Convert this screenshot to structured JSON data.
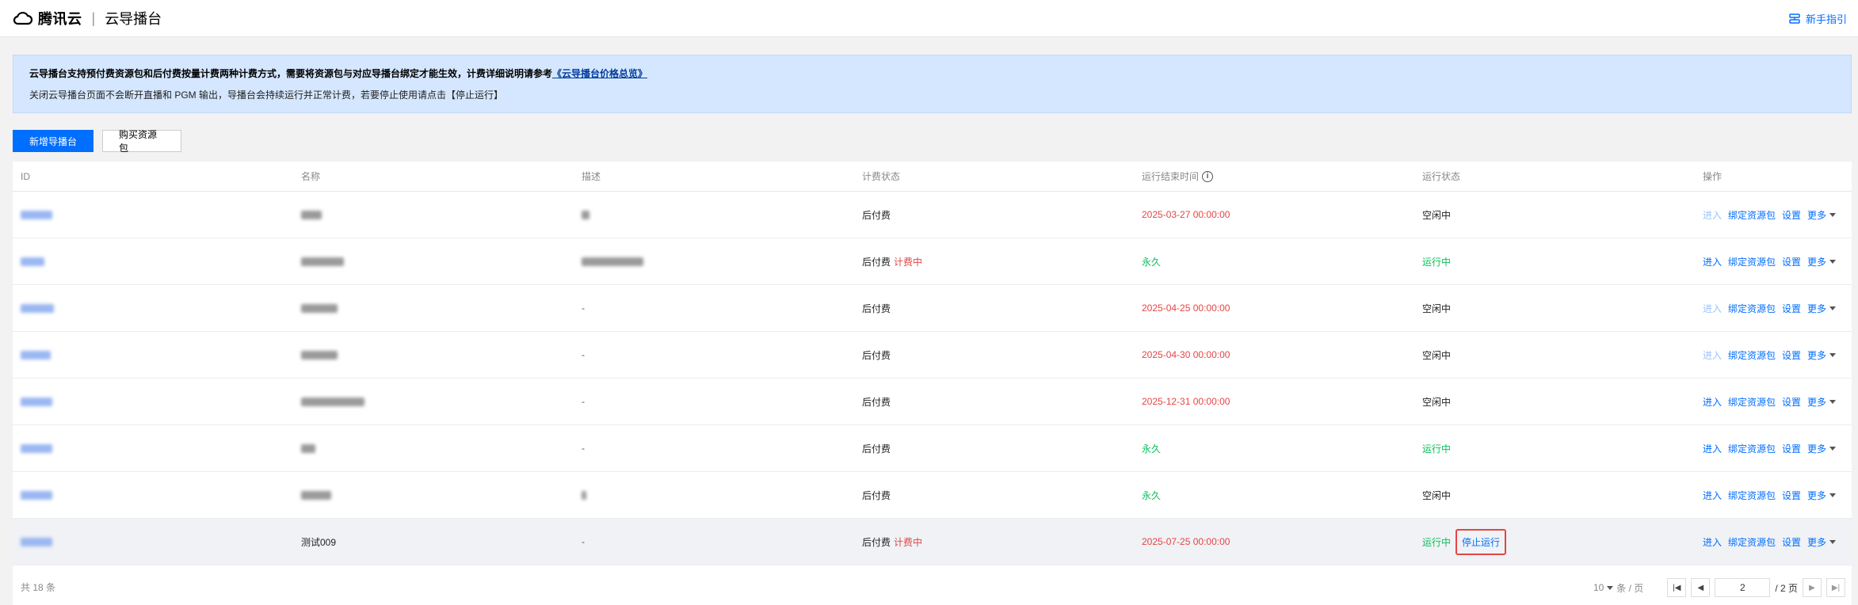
{
  "header": {
    "brand": "腾讯云",
    "separator": "|",
    "product": "云导播台",
    "guide": "新手指引"
  },
  "notice": {
    "line1": "云导播台支持预付费资源包和后付费按量计费两种计费方式，需要将资源包与对应导播台绑定才能生效，计费详细说明请参考",
    "line1_link": "《云导播台价格总览》",
    "line2": "关闭云导播台页面不会断开直播和 PGM 输出，导播台会持续运行并正常计费，若要停止使用请点击【停止运行】"
  },
  "toolbar": {
    "new_label": "新增导播台",
    "buy_label": "购买资源包"
  },
  "table": {
    "columns": [
      "ID",
      "名称",
      "描述",
      "计费状态",
      "运行结束时间",
      "运行状态",
      "操作"
    ],
    "rows": [
      {
        "name": "",
        "desc": "",
        "bill": "后付费",
        "billing": "",
        "end": "2025-03-27 00:00:00",
        "end_color": "red",
        "run": "空闲中",
        "run_color": "dark",
        "enter_disabled": true
      },
      {
        "name": "",
        "desc": "",
        "bill": "后付费",
        "billing": "计费中",
        "end": "永久",
        "end_color": "green",
        "run": "运行中",
        "run_color": "green",
        "enter_disabled": false
      },
      {
        "name": "",
        "desc": "-",
        "bill": "后付费",
        "billing": "",
        "end": "2025-04-25 00:00:00",
        "end_color": "red",
        "run": "空闲中",
        "run_color": "dark",
        "enter_disabled": true
      },
      {
        "name": "",
        "desc": "-",
        "bill": "后付费",
        "billing": "",
        "end": "2025-04-30 00:00:00",
        "end_color": "red",
        "run": "空闲中",
        "run_color": "dark",
        "enter_disabled": true
      },
      {
        "name": "",
        "desc": "-",
        "bill": "后付费",
        "billing": "",
        "end": "2025-12-31 00:00:00",
        "end_color": "red",
        "run": "空闲中",
        "run_color": "dark",
        "enter_disabled": false
      },
      {
        "name": "",
        "desc": "-",
        "bill": "后付费",
        "billing": "",
        "end": "永久",
        "end_color": "green",
        "run": "运行中",
        "run_color": "green",
        "enter_disabled": false
      },
      {
        "name": "",
        "desc": "",
        "bill": "后付费",
        "billing": "",
        "end": "永久",
        "end_color": "green",
        "run": "空闲中",
        "run_color": "dark",
        "enter_disabled": false
      },
      {
        "name": "测试009",
        "desc": "-",
        "bill": "后付费",
        "billing": "计费中",
        "end": "2025-07-25 00:00:00",
        "end_color": "red",
        "run": "运行中",
        "run_color": "green",
        "enter_disabled": false,
        "stop": "停止运行"
      }
    ],
    "ops": {
      "enter": "进入",
      "bind": "绑定资源包",
      "settings": "设置",
      "more": "更多"
    }
  },
  "footer": {
    "total": "共 18 条",
    "page_size": "10",
    "per_page": "条 / 页",
    "current_page": "2",
    "total_pages": "/ 2 页"
  }
}
